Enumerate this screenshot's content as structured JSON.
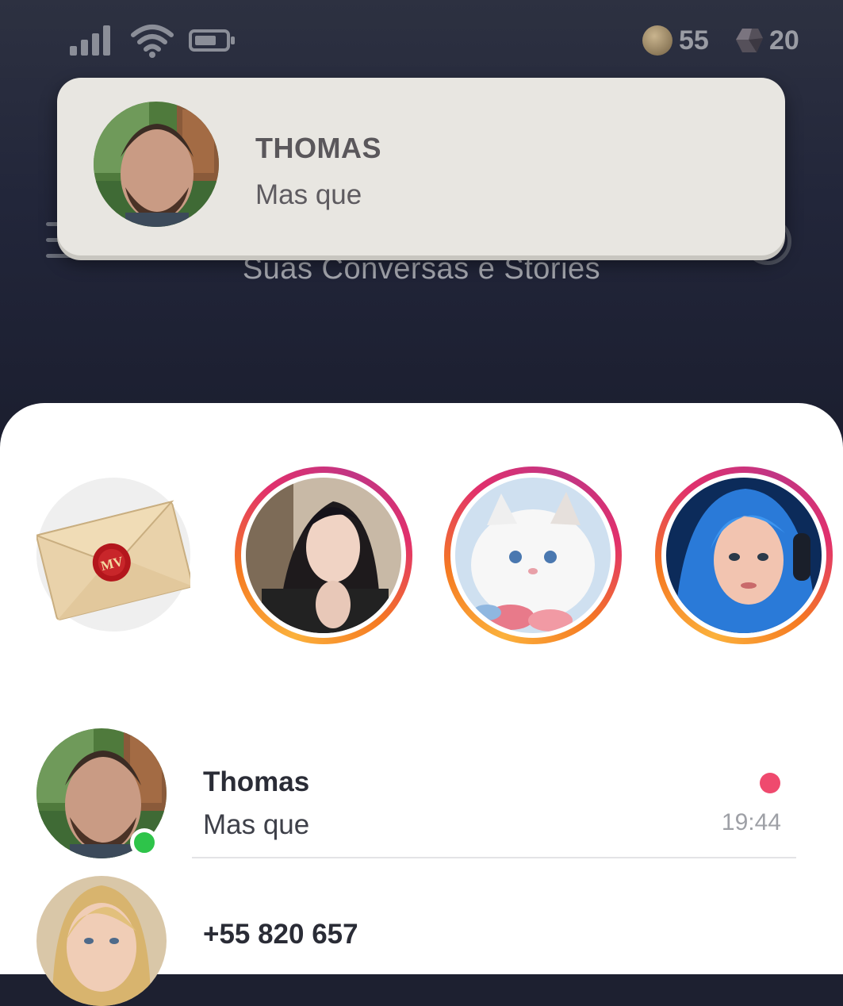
{
  "status_bar": {
    "coins": "55",
    "gems": "20",
    "icons": [
      "signal-icon",
      "wifi-icon",
      "battery-icon",
      "coin-icon",
      "gem-icon"
    ]
  },
  "header": {
    "subtitle": "Suas Conversas e Stories"
  },
  "notification": {
    "title": "THOMAS",
    "message": "Mas que"
  },
  "stories": {
    "inbox_seal_text": "MV",
    "items": [
      {
        "label": "story-woman-dark-hair"
      },
      {
        "label": "story-white-kitten"
      },
      {
        "label": "story-blue-hair-girl"
      }
    ]
  },
  "chats": [
    {
      "name": "Thomas",
      "preview": "Mas que",
      "time": "19:44",
      "online": true,
      "unread": true
    },
    {
      "name": "+55 820 657",
      "preview": "",
      "time": "",
      "online": false,
      "unread": false
    }
  ],
  "colors": {
    "background": "#1d2030",
    "panel": "#ffffff",
    "notification": "#e8e6e1",
    "online": "#2ec44a",
    "unread": "#ef4a6e"
  }
}
